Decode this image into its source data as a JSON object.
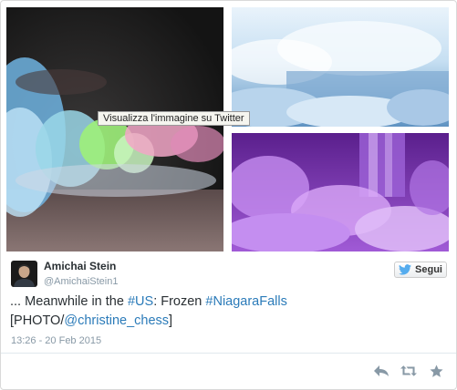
{
  "media": {
    "tooltip": "Visualizza l'immagine su Twitter",
    "images": [
      {
        "icon": "photo-frozen-falls-colored-lights"
      },
      {
        "icon": "photo-frozen-falls-daylight"
      },
      {
        "icon": "photo-frozen-falls-purple"
      }
    ]
  },
  "author": {
    "name": "Amichai Stein",
    "handle": "@AmichaiStein1",
    "avatar_icon": "user-avatar"
  },
  "follow_button": {
    "label": "Segui",
    "icon": "twitter-bird-icon",
    "color": "#55acee"
  },
  "tweet": {
    "prefix": "... Meanwhile in the ",
    "hashtag_us": "#US",
    "middle": ": Frozen ",
    "hashtag_niagara": "#NiagaraFalls",
    "photo_open": "[PHOTO/",
    "mention": "@christine_chess",
    "photo_close": "]",
    "link_color": "#2b7bb9"
  },
  "timestamp": "13:26 - 20 Feb 2015",
  "actions": [
    {
      "icon": "reply-icon"
    },
    {
      "icon": "retweet-icon"
    },
    {
      "icon": "favorite-star-icon"
    }
  ]
}
